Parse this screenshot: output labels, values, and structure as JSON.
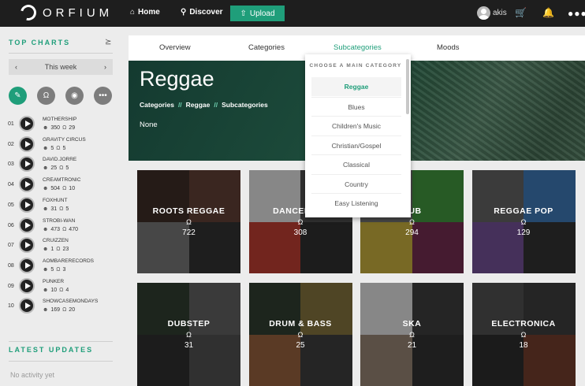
{
  "header": {
    "logo_text": "ORFIUM",
    "nav": [
      {
        "label": "Home",
        "icon": "home-icon"
      },
      {
        "label": "Discover",
        "icon": "search-icon"
      }
    ],
    "upload_label": "Upload",
    "username": "akis",
    "icons": [
      "cart-icon",
      "bell-icon",
      "more-icon"
    ]
  },
  "sidebar": {
    "top_charts_title": "TOP CHARTS",
    "period": "This week",
    "filters": [
      "mic-icon",
      "headphones-icon",
      "disc-icon",
      "more-icon"
    ],
    "charts": [
      {
        "rank": "01",
        "artist": "MOTHERSHIP",
        "followers": "350",
        "plays": "29"
      },
      {
        "rank": "02",
        "artist": "GRAVITY CIRCUS",
        "followers": "5",
        "plays": "5"
      },
      {
        "rank": "03",
        "artist": "DAVID.JORRE",
        "followers": "25",
        "plays": "5"
      },
      {
        "rank": "04",
        "artist": "CREAMTRONIC",
        "followers": "504",
        "plays": "10"
      },
      {
        "rank": "05",
        "artist": "FOXHUNT",
        "followers": "31",
        "plays": "5"
      },
      {
        "rank": "06",
        "artist": "STROBI-WAN",
        "followers": "473",
        "plays": "470"
      },
      {
        "rank": "07",
        "artist": "CRUIZZEN",
        "followers": "1",
        "plays": "23"
      },
      {
        "rank": "08",
        "artist": "AOMBARERECORDS",
        "followers": "5",
        "plays": "3"
      },
      {
        "rank": "09",
        "artist": "PUNKER",
        "followers": "10",
        "plays": "4"
      },
      {
        "rank": "10",
        "artist": "SHOWCASEMONDAYS",
        "followers": "169",
        "plays": "20"
      }
    ],
    "latest_title": "LATEST UPDATES",
    "no_activity": "No activity yet"
  },
  "tabs": [
    {
      "label": "Overview"
    },
    {
      "label": "Categories"
    },
    {
      "label": "Subcategories",
      "active": true
    },
    {
      "label": "Moods"
    }
  ],
  "hero": {
    "title": "Reggae",
    "breadcrumbs": [
      "Categories",
      "Reggae",
      "Subcategories"
    ],
    "separator": "//",
    "none_label": "None"
  },
  "dropdown": {
    "heading": "CHOOSE A MAIN CATEGORY",
    "items": [
      "Reggae",
      "Blues",
      "Children's Music",
      "Christian/Gospel",
      "Classical",
      "Country",
      "Easy Listening"
    ],
    "selected": "Reggae"
  },
  "cards": [
    {
      "name": "ROOTS REGGAE",
      "count": "722",
      "colors": [
        "#3a2a24",
        "#5a3b32",
        "#6e6e6e",
        "#2f2f2f"
      ]
    },
    {
      "name": "DANCEHALL",
      "count": "308",
      "colors": [
        "#cfcfcf",
        "#4a4a4a",
        "#b03a2e",
        "#2b2b2b"
      ]
    },
    {
      "name": "DUB",
      "count": "294",
      "colors": [
        "#6c6c6c",
        "#3d8a3a",
        "#b8a13a",
        "#6a2a4a"
      ]
    },
    {
      "name": "REGGAE POP",
      "count": "129",
      "colors": [
        "#5b5b5b",
        "#3a6fa8",
        "#6a4a8a",
        "#2e2e2e"
      ]
    },
    {
      "name": "DUBSTEP",
      "count": "31",
      "colors": [
        "#2d3a2d",
        "#5a5a5a",
        "#2b2b2b",
        "#4a4a4a"
      ]
    },
    {
      "name": "DRUM & BASS",
      "count": "25",
      "colors": [
        "#2d3a2d",
        "#7a6a3a",
        "#8a5a3a",
        "#3a3a3a"
      ]
    },
    {
      "name": "SKA",
      "count": "21",
      "colors": [
        "#cfcfcf",
        "#3a3a3a",
        "#8a7a6a",
        "#2f2f2f"
      ]
    },
    {
      "name": "ELECTRONICA",
      "count": "18",
      "colors": [
        "#4a4a4a",
        "#3a3a3a",
        "#2a2a2a",
        "#6a3a2a"
      ]
    }
  ],
  "colors": {
    "accent": "#1f9e7a",
    "topbar": "#1e1e1e"
  }
}
